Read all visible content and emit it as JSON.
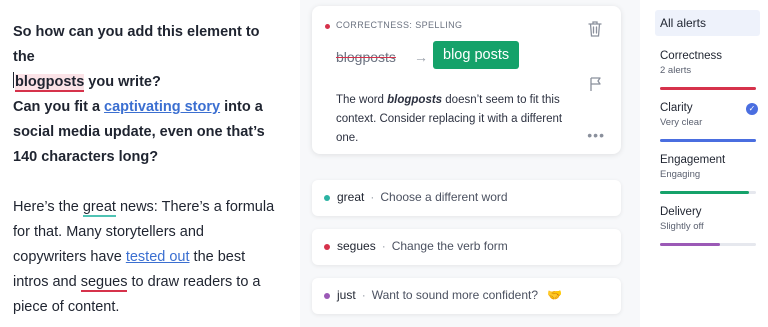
{
  "editor": {
    "p1": {
      "t1": "So how can you add this element to the",
      "flag_word": "blogposts",
      "t2": " you write?"
    },
    "p2": {
      "t1": "Can you fit a ",
      "link": "captivating story",
      "t2": " into a",
      "line2": "social media update, even one that’s",
      "line3": "140 characters long?"
    },
    "p3": {
      "t1": "Here’s the ",
      "w_great": "great",
      "t2": " news: There’s a formula",
      "line2": "for that. Many storytellers and",
      "l3a": "copywriters have ",
      "link": "tested out",
      "l3b": " the best",
      "l4a": "intros and ",
      "w_segues": "segues",
      "l4b": " to draw readers to a",
      "line5": "piece of content."
    }
  },
  "card": {
    "category": "CORRECTNESS: SPELLING",
    "original": "blogposts",
    "arrow": "→",
    "suggestion": "blog posts",
    "desc_a": "The word ",
    "desc_word": "blogposts",
    "desc_b": " doesn’t seem to fit this context. Consider replacing it with a different one.",
    "more": "•••",
    "colors": {
      "dot": "#d6324b",
      "suggestion_bg": "#15a26a"
    }
  },
  "alerts": [
    {
      "word": "great",
      "sep": "·",
      "hint": "Choose a different word",
      "color": "#2bb3a3"
    },
    {
      "word": "segues",
      "sep": "·",
      "hint": "Change the verb form",
      "color": "#d6324b"
    },
    {
      "word": "just",
      "sep": "·",
      "hint": "Want to sound more confident?",
      "emoji": "🤝",
      "color": "#9b59b6"
    }
  ],
  "sidebar": {
    "all_alerts": "All alerts",
    "categories": [
      {
        "name": "Correctness",
        "sub": "2 alerts",
        "color": "#d6324b",
        "fill_fraction": 1.0
      },
      {
        "name": "Clarity",
        "sub": "Very clear",
        "color": "#4a6ee0",
        "fill_fraction": 1.0,
        "check": "✓"
      },
      {
        "name": "Engagement",
        "sub": "Engaging",
        "color": "#15a26a",
        "fill_fraction": 0.93
      },
      {
        "name": "Delivery",
        "sub": "Slightly off",
        "color": "#9b59b6",
        "fill_fraction": 0.62
      }
    ]
  }
}
